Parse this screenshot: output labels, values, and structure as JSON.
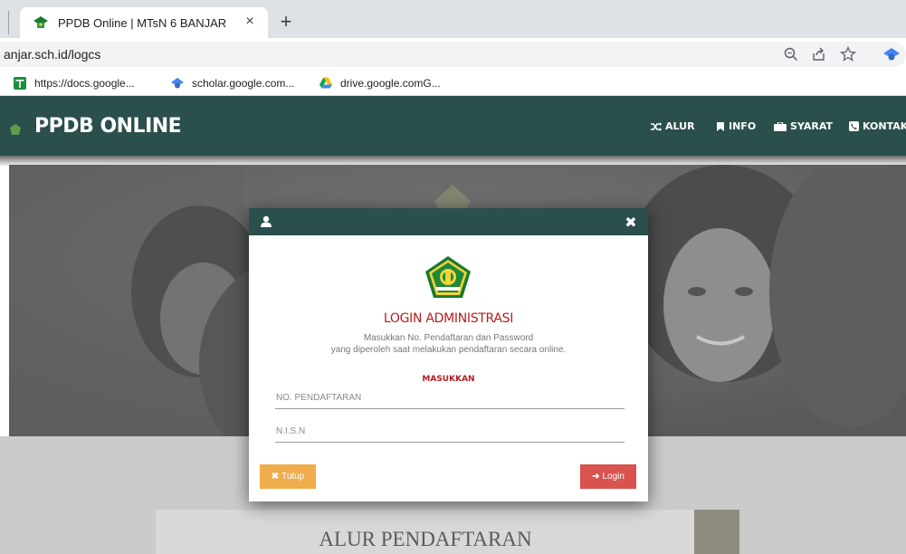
{
  "browser": {
    "tab_title": "PPDB Online | MTsN 6 BANJAR",
    "tab_close": "×",
    "new_tab": "+",
    "url": "anjar.sch.id/logcs",
    "bookmarks": [
      {
        "label": "https://docs.google..."
      },
      {
        "label": "scholar.google.com..."
      },
      {
        "label": "drive.google.comG..."
      }
    ]
  },
  "site": {
    "brand": "PPDB ONLINE",
    "nav": [
      {
        "label": "ALUR",
        "icon": "shuffle-icon"
      },
      {
        "label": "INFO",
        "icon": "bookmark-icon"
      },
      {
        "label": "SYARAT",
        "icon": "briefcase-icon"
      },
      {
        "label": "KONTAK",
        "icon": "phone-icon"
      }
    ],
    "section_title": "ALUR PENDAFTARAN"
  },
  "modal": {
    "close_glyph": "✖",
    "title": "LOGIN ADMINISTRASI",
    "desc_line1": "Masukkan No. Pendaftaran dan Password",
    "desc_line2": "yang diperoleh saat melakukan pendaftaran secara online.",
    "subtitle": "MASUKKAN",
    "field1_placeholder": "NO. PENDAFTARAN",
    "field2_placeholder": "N.I.S.N",
    "close_button": "Tutup",
    "close_button_icon": "✖",
    "login_button": "Login",
    "login_button_icon": "➜"
  },
  "colors": {
    "primary": "#2a4f4c",
    "accent_red": "#b71c1c",
    "btn_warning": "#f0ad4e",
    "btn_danger": "#d9534f"
  }
}
